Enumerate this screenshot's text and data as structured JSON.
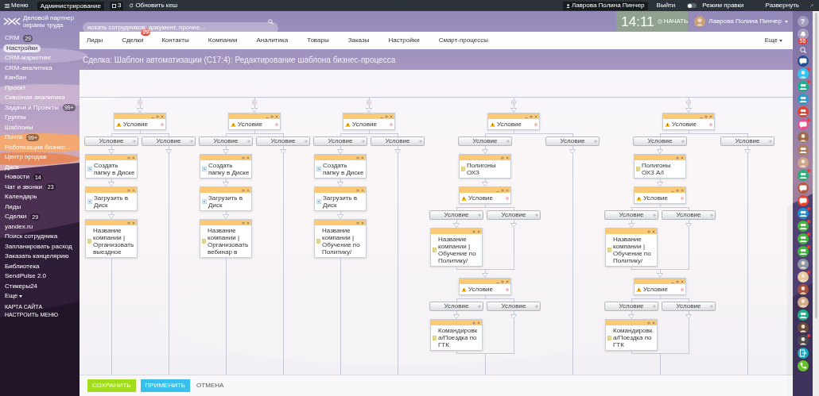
{
  "top_bar": {
    "menu": "Меню",
    "admin": "Администрирование",
    "notifications": "3",
    "refresh": "Обновить кеш",
    "user": "Лаврова Полина Пинчер",
    "logout": "Выйти",
    "edit_mode": {
      "label": "Режим правки",
      "on": false
    },
    "expand": "Развернуть"
  },
  "header": {
    "logo_text": "Деловой партнер охраны труда",
    "search": {
      "placeholder": "искать сотрудников, документ, прочее..."
    },
    "clock": "14:11",
    "start": "НАЧАТЬ",
    "user": "Лаврова Полина Пинчер"
  },
  "sidebar": {
    "items": [
      {
        "label": "CRM",
        "counter": "29",
        "selected": false
      },
      {
        "label": "Настройки",
        "selected": true
      },
      {
        "label": "CRM-маркетинг",
        "selected": false
      },
      {
        "label": "CRM-аналитика",
        "selected": false
      },
      {
        "label": "Канбан",
        "selected": false
      },
      {
        "label": "Проект",
        "selected": false
      },
      {
        "label": "Сквозная аналитика",
        "selected": false
      },
      {
        "label": "Задачи и Проекты",
        "counter": "99+",
        "selected": false
      },
      {
        "label": "Группы",
        "selected": false
      },
      {
        "label": "Шаблоны",
        "selected": false
      },
      {
        "label": "Почта",
        "counter": "99+",
        "selected": false
      },
      {
        "label": "Роботизация бизнес...",
        "selected": false
      },
      {
        "label": "Центр продаж",
        "selected": false
      },
      {
        "label": "Диск",
        "selected": false
      },
      {
        "label": "Новости",
        "counter": "14",
        "selected": false
      },
      {
        "label": "Чат и звонки",
        "counter": "23",
        "selected": false
      },
      {
        "label": "Календарь",
        "selected": false
      },
      {
        "label": "Лиды",
        "selected": false
      },
      {
        "label": "Сделки",
        "counter": "29",
        "selected": false
      },
      {
        "label": "yandex.ru",
        "selected": false
      },
      {
        "label": "Поиск сотрудника",
        "selected": false
      },
      {
        "label": "Запланировать расход",
        "selected": false
      },
      {
        "label": "Заказать канцелярию",
        "selected": false
      },
      {
        "label": "Библиотека",
        "selected": false
      },
      {
        "label": "SendPulse 2.0",
        "selected": false
      },
      {
        "label": "Стикеры24",
        "selected": false
      }
    ],
    "more": "Еще",
    "links": [
      "КАРТА САЙТА",
      "НАСТРОИТЬ МЕНЮ"
    ]
  },
  "menu": {
    "tabs": [
      {
        "label": "Лиды",
        "selected": false
      },
      {
        "label": "Сделки",
        "counter": "29",
        "selected": false
      },
      {
        "label": "Контакты",
        "selected": false
      },
      {
        "label": "Компании",
        "selected": false
      },
      {
        "label": "Аналитика",
        "selected": false
      },
      {
        "label": "Товары",
        "selected": false
      },
      {
        "label": "Заказы",
        "selected": false
      },
      {
        "label": "Настройки",
        "selected": false
      },
      {
        "label": "Смарт-процессы",
        "selected": false
      }
    ],
    "more": "Еще"
  },
  "page_title": "Сделка: Шаблон автоматизации (C17:4): Редактирование шаблона бизнес-процесса",
  "workflow": {
    "columns": [
      {
        "kind": "condition",
        "label": "Условие",
        "branches": [
          {
            "label": "Условие",
            "steps": [
              {
                "kind": "disk_action",
                "text": "Создать папку в Диске"
              },
              {
                "kind": "disk_action",
                "text": "Загрузить в Диск"
              },
              {
                "kind": "document_action",
                "text": "Название компании | Организовать выездное"
              }
            ]
          },
          {
            "label": "Условие"
          }
        ]
      },
      {
        "kind": "condition",
        "label": "Условие",
        "branches": [
          {
            "label": "Условие",
            "steps": [
              {
                "kind": "disk_action",
                "text": "Создать папку в Диске"
              },
              {
                "kind": "disk_action",
                "text": "Загрузить в Диск"
              },
              {
                "kind": "document_action",
                "text": "Название компании | Организовать вебинар в"
              }
            ]
          },
          {
            "label": "Условие"
          }
        ]
      },
      {
        "kind": "condition",
        "label": "Условие",
        "branches": [
          {
            "label": "Условие",
            "steps": [
              {
                "kind": "disk_action",
                "text": "Создать папку в Диске"
              },
              {
                "kind": "disk_action",
                "text": "Загрузить в Диск"
              },
              {
                "kind": "document_action",
                "text": "Название компании | Обучение по Политику/"
              }
            ]
          },
          {
            "label": "Условие"
          }
        ]
      },
      {
        "kind": "condition",
        "label": "Условие",
        "branches": [
          {
            "label": "Условие",
            "steps": [
              {
                "kind": "document_action",
                "text": "Полигоны ОХЗ"
              },
              {
                "kind": "condition",
                "label": "Условие",
                "branches": [
                  {
                    "label": "Условие",
                    "steps": [
                      {
                        "kind": "document_action",
                        "text": "Название компании | Обучение по Политику/"
                      }
                    ]
                  },
                  {
                    "label": "Условие"
                  }
                ]
              },
              {
                "kind": "condition",
                "label": "Условие",
                "branches": [
                  {
                    "label": "Условие",
                    "steps": [
                      {
                        "kind": "document_action",
                        "text": "Командировка/Поездка по ГТК"
                      }
                    ]
                  },
                  {
                    "label": "Условие"
                  }
                ]
              }
            ]
          },
          {
            "label": "Условие"
          }
        ]
      },
      {
        "kind": "condition",
        "label": "Условие",
        "branches": [
          {
            "label": "Условие",
            "steps": [
              {
                "kind": "document_action",
                "text": "Полигоны ОХЗ А/I"
              },
              {
                "kind": "condition",
                "label": "Условие",
                "branches": [
                  {
                    "label": "Условие",
                    "steps": [
                      {
                        "kind": "document_action",
                        "text": "Название компании | Обучение по Политику/"
                      }
                    ]
                  },
                  {
                    "label": "Условие"
                  }
                ]
              },
              {
                "kind": "condition",
                "label": "Условие",
                "branches": [
                  {
                    "label": "Условие",
                    "steps": [
                      {
                        "kind": "document_action",
                        "text": "Командировка/Поездка по ГТК"
                      }
                    ]
                  },
                  {
                    "label": "Условие"
                  }
                ]
              }
            ]
          },
          {
            "label": "Условие"
          }
        ]
      }
    ]
  },
  "buttons": {
    "save": "СОХРАНИТЬ",
    "apply": "ПРИМЕНИТЬ",
    "cancel": "ОТМЕНА"
  },
  "right_bar": {
    "help": "?",
    "notifications_counter": "56",
    "contacts": [
      {
        "kind": "chat",
        "color": "#1d4f91",
        "badge": false
      },
      {
        "kind": "person",
        "color": "#2fc6f6",
        "badge": true
      },
      {
        "kind": "group",
        "color": "#12b38c",
        "badge": true
      },
      {
        "kind": "group",
        "color": "#2a9bd1",
        "badge": false
      },
      {
        "kind": "group",
        "color": "#e5432f",
        "badge": false
      },
      {
        "kind": "chat",
        "color": "#ee4e8c",
        "badge": true
      },
      {
        "kind": "person",
        "color": "#9a6a4e",
        "badge": false
      },
      {
        "kind": "group",
        "color": "#b47b5a",
        "badge": false
      },
      {
        "kind": "person",
        "color": "#c9a48a",
        "badge": false
      },
      {
        "kind": "group",
        "color": "#20b477",
        "badge": true
      },
      {
        "kind": "chat",
        "color": "#b35a3f",
        "badge": false
      },
      {
        "kind": "chat",
        "color": "#e8432d",
        "badge": false
      },
      {
        "kind": "group",
        "color": "#1f8dd6",
        "badge": true
      },
      {
        "kind": "group",
        "color": "#3fb53a",
        "badge": true
      },
      {
        "kind": "group",
        "color": "#3fb53a",
        "badge": true
      },
      {
        "kind": "group",
        "color": "#3fb53a",
        "badge": true
      },
      {
        "kind": "person",
        "color": "#8d9aa6",
        "badge": false
      },
      {
        "kind": "person",
        "color": "#e7c79c",
        "badge": true
      },
      {
        "kind": "person",
        "color": "#a0503c",
        "badge": false
      },
      {
        "kind": "person",
        "color": "#d2aa88",
        "badge": false
      },
      {
        "kind": "group",
        "color": "#1eb288",
        "badge": false
      },
      {
        "kind": "person",
        "color": "#6a4a3a",
        "badge": false
      },
      {
        "kind": "person",
        "color": "#4a4a50",
        "badge": true
      },
      {
        "kind": "exit",
        "color": "#1aa9c0",
        "badge": false
      },
      {
        "kind": "call",
        "color": "#67c12e",
        "badge": false
      }
    ]
  }
}
